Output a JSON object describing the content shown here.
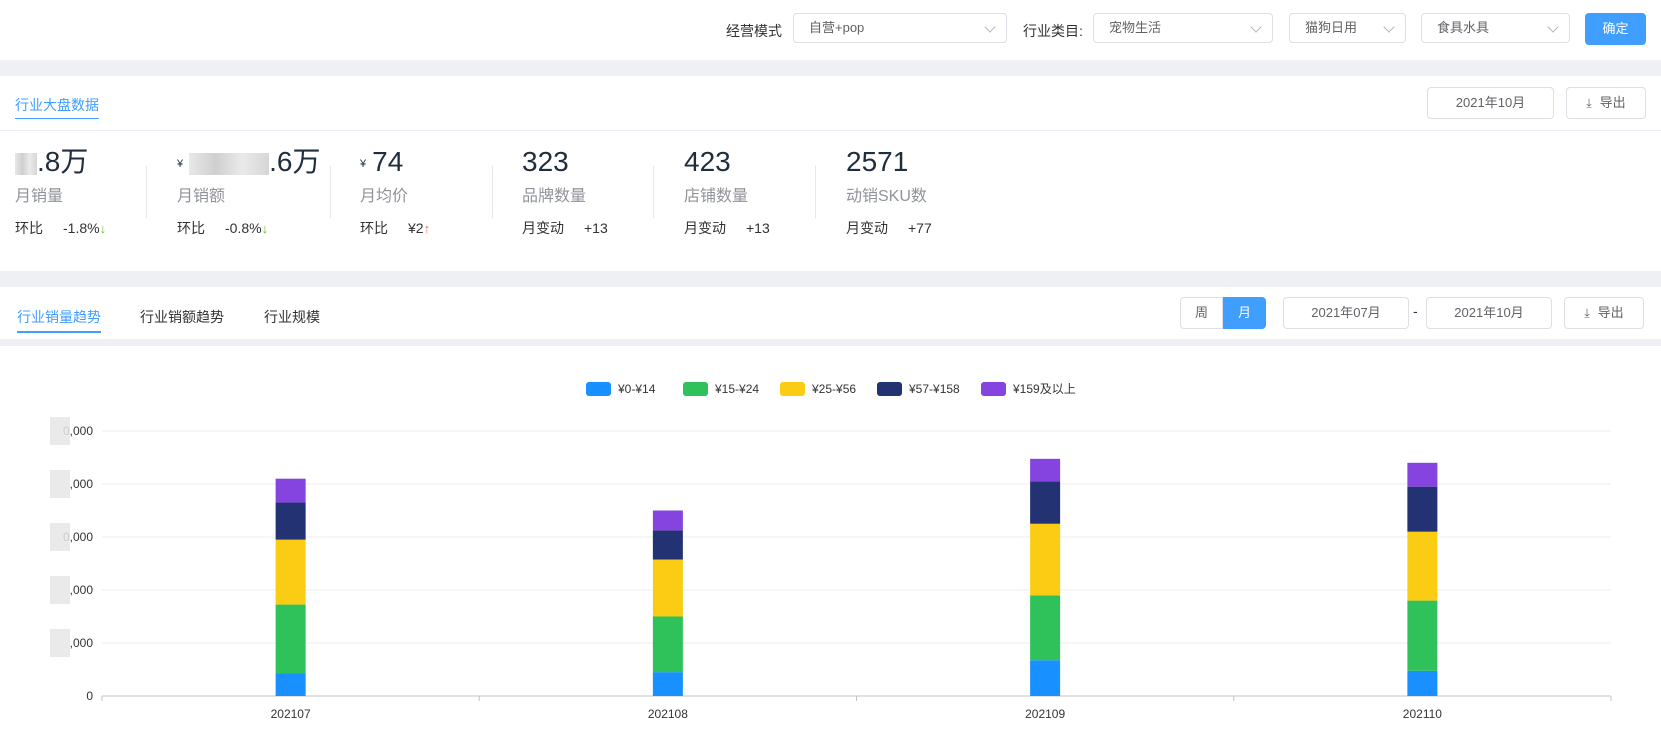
{
  "filters": {
    "mode_label": "经营模式",
    "mode_value": "自营+pop",
    "category_label": "行业类目:",
    "category_value": "宠物生活",
    "sub_category_value": "猫狗日用",
    "leaf_category_value": "食具水具",
    "confirm_label": "确定"
  },
  "overview": {
    "title": "行业大盘数据",
    "month": "2021年10月",
    "export_label": "导出",
    "stats": [
      {
        "value": ".8万",
        "currency": "",
        "label": "月销量",
        "change_label": "环比",
        "change": "-1.8%",
        "arrow": "↓"
      },
      {
        "value": ".6万",
        "currency": "¥",
        "label": "月销额",
        "change_label": "环比",
        "change": "-0.8%",
        "arrow": "↓"
      },
      {
        "value": "74",
        "currency": "¥",
        "label": "月均价",
        "change_label": "环比",
        "change": "¥2",
        "arrow": "↑"
      },
      {
        "value": "323",
        "currency": "",
        "label": "品牌数量",
        "change_label": "月变动",
        "change": "+13",
        "arrow": ""
      },
      {
        "value": "423",
        "currency": "",
        "label": "店铺数量",
        "change_label": "月变动",
        "change": "+13",
        "arrow": ""
      },
      {
        "value": "2571",
        "currency": "",
        "label": "动销SKU数",
        "change_label": "月变动",
        "change": "+77",
        "arrow": ""
      }
    ]
  },
  "trend": {
    "tabs": [
      "行业销量趋势",
      "行业销额趋势",
      "行业规模"
    ],
    "week_label": "周",
    "month_label": "月",
    "start_month": "2021年07月",
    "range_sep": "-",
    "end_month": "2021年10月",
    "export_label": "导出"
  },
  "colors": {
    "accent": "#409eff",
    "down": "#67c23a",
    "up": "#f56c6c"
  },
  "chart_data": {
    "type": "bar",
    "stacked": true,
    "categories": [
      "202107",
      "202108",
      "202109",
      "202110"
    ],
    "series": [
      {
        "name": "¥0-¥14",
        "color": "#1890ff",
        "values": [
          0.85,
          0.9,
          1.35,
          0.95
        ]
      },
      {
        "name": "¥15-¥24",
        "color": "#2fc25b",
        "values": [
          2.6,
          2.1,
          2.45,
          2.65
        ]
      },
      {
        "name": "¥25-¥56",
        "color": "#facc14",
        "values": [
          2.45,
          2.15,
          2.7,
          2.6
        ]
      },
      {
        "name": "¥57-¥158",
        "color": "#223273",
        "values": [
          1.4,
          1.1,
          1.6,
          1.7
        ]
      },
      {
        "name": "¥159及以上",
        "color": "#8543e0",
        "values": [
          0.9,
          0.75,
          0.85,
          0.9
        ]
      }
    ],
    "ytick_values": [
      0,
      2,
      4,
      6,
      8,
      10
    ],
    "ytick_labels": [
      "0",
      ",000",
      ",000",
      "0,000",
      ",000",
      "0,000"
    ],
    "ylim": [
      0,
      10
    ],
    "legend_position": "top-center",
    "grid": true
  }
}
